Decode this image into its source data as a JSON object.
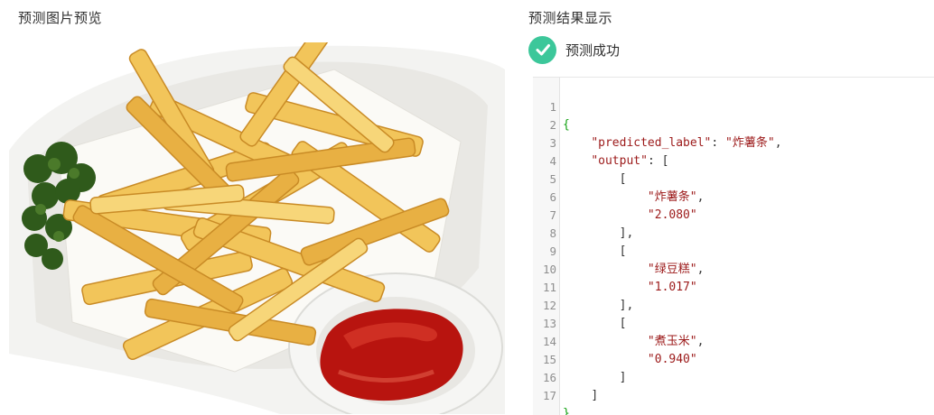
{
  "left_panel": {
    "title": "预测图片预览"
  },
  "right_panel": {
    "title": "预测结果显示",
    "status": {
      "text": "预测成功",
      "icon": "check-circle-icon",
      "color": "#3cc79a"
    }
  },
  "code": {
    "line_numbers": [
      "1",
      "2",
      "3",
      "4",
      "5",
      "6",
      "7",
      "8",
      "9",
      "10",
      "11",
      "12",
      "13",
      "14",
      "15",
      "16",
      "17"
    ],
    "open_brace": "{",
    "close_brace": "}",
    "key_predicted_label": "\"predicted_label\"",
    "value_predicted_label": "\"炸薯条\"",
    "key_output": "\"output\"",
    "open_bracket": "[",
    "close_bracket": "]",
    "close_bracket_comma": "],",
    "items": [
      {
        "label": "\"炸薯条\"",
        "score": "\"2.080\""
      },
      {
        "label": "\"绿豆糕\"",
        "score": "\"1.017\""
      },
      {
        "label": "\"煮玉米\"",
        "score": "\"0.940\""
      }
    ]
  }
}
